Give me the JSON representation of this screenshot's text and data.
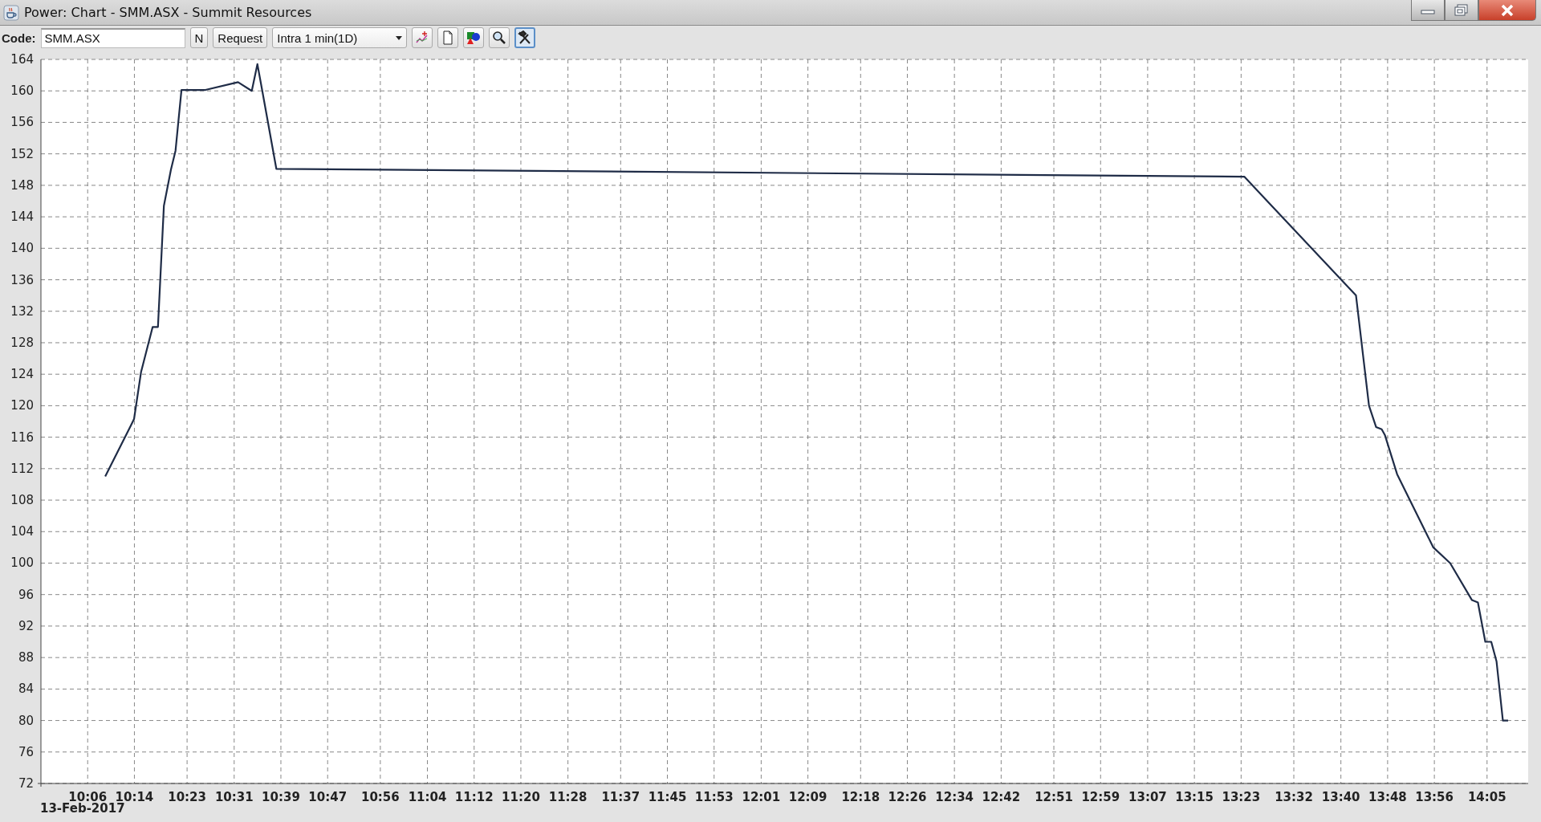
{
  "window": {
    "title": "Power: Chart - SMM.ASX - Summit Resources"
  },
  "toolbar": {
    "code_label": "Code:",
    "code_value": "SMM.ASX",
    "buttons": [
      "N",
      "Request"
    ],
    "interval": "Intra 1 min(1D)",
    "tool_buttons": [
      {
        "kind": "indicator",
        "selected": false
      },
      {
        "kind": "page",
        "selected": false
      },
      {
        "kind": "shapes",
        "selected": false
      },
      {
        "kind": "zoom",
        "selected": false
      },
      {
        "kind": "tools",
        "selected": true
      }
    ]
  },
  "chart": {
    "date_label": "13-Feb-2017",
    "chart_data": {
      "type": "line",
      "grid": true,
      "x": [
        10.15,
        10.223,
        10.232,
        10.252,
        10.285,
        10.3,
        10.317,
        10.337,
        10.35,
        10.367,
        10.433,
        10.528,
        10.567,
        10.583,
        10.597,
        10.637,
        13.392,
        13.71,
        13.747,
        13.767,
        13.783,
        13.792,
        13.827,
        13.93,
        13.978,
        14.04,
        14.057,
        14.078,
        14.095,
        14.11,
        14.128,
        14.143
      ],
      "series": [
        {
          "color": "#1f2c47",
          "values": [
            111,
            117.5,
            118.3,
            124.3,
            130,
            130,
            145.4,
            150,
            152.4,
            160.1,
            160.1,
            161.1,
            160,
            163.4,
            160,
            150.1,
            149.1,
            134,
            120,
            117.3,
            117,
            116.3,
            111.3,
            102,
            100,
            95.3,
            95,
            90,
            90,
            87.5,
            80,
            80
          ]
        }
      ],
      "xlim": [
        9.967,
        14.2
      ],
      "ylim": [
        72,
        164
      ],
      "xticks": [
        {
          "value": 10.1,
          "label": "10:06"
        },
        {
          "value": 10.233,
          "label": "10:14"
        },
        {
          "value": 10.383,
          "label": "10:23"
        },
        {
          "value": 10.517,
          "label": "10:31"
        },
        {
          "value": 10.65,
          "label": "10:39"
        },
        {
          "value": 10.783,
          "label": "10:47"
        },
        {
          "value": 10.933,
          "label": "10:56"
        },
        {
          "value": 11.067,
          "label": "11:04"
        },
        {
          "value": 11.2,
          "label": "11:12"
        },
        {
          "value": 11.333,
          "label": "11:20"
        },
        {
          "value": 11.467,
          "label": "11:28"
        },
        {
          "value": 11.617,
          "label": "11:37"
        },
        {
          "value": 11.75,
          "label": "11:45"
        },
        {
          "value": 11.883,
          "label": "11:53"
        },
        {
          "value": 12.017,
          "label": "12:01"
        },
        {
          "value": 12.15,
          "label": "12:09"
        },
        {
          "value": 12.3,
          "label": "12:18"
        },
        {
          "value": 12.433,
          "label": "12:26"
        },
        {
          "value": 12.567,
          "label": "12:34"
        },
        {
          "value": 12.7,
          "label": "12:42"
        },
        {
          "value": 12.85,
          "label": "12:51"
        },
        {
          "value": 12.983,
          "label": "12:59"
        },
        {
          "value": 13.117,
          "label": "13:07"
        },
        {
          "value": 13.25,
          "label": "13:15"
        },
        {
          "value": 13.383,
          "label": "13:23"
        },
        {
          "value": 13.533,
          "label": "13:32"
        },
        {
          "value": 13.667,
          "label": "13:40"
        },
        {
          "value": 13.8,
          "label": "13:48"
        },
        {
          "value": 13.933,
          "label": "13:56"
        },
        {
          "value": 14.083,
          "label": "14:05"
        }
      ],
      "yticks": [
        72,
        76,
        80,
        84,
        88,
        92,
        96,
        100,
        104,
        108,
        112,
        116,
        120,
        124,
        128,
        132,
        136,
        140,
        144,
        148,
        152,
        156,
        160,
        164
      ]
    }
  }
}
